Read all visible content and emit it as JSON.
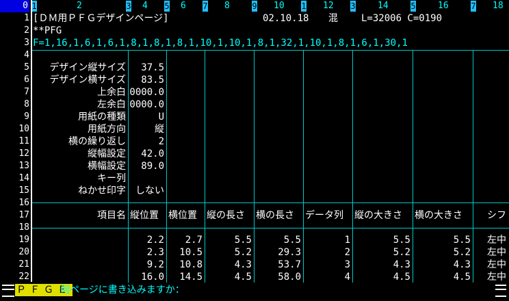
{
  "ruler": {
    "current": "0",
    "labels": [
      "1",
      "2",
      "3",
      "4",
      "5",
      "6",
      "7",
      "8",
      "9",
      "10",
      "1",
      "12",
      "3",
      "14",
      "5",
      "16",
      "7",
      "18"
    ],
    "ticks": [
      "1",
      "3",
      "5",
      "7",
      "9",
      "1",
      "3",
      "5",
      "7"
    ]
  },
  "rows": [
    "0",
    "1",
    "2",
    "3",
    "4",
    "5",
    "6",
    "7",
    "8",
    "9",
    "10",
    "11",
    "12",
    "13",
    "14",
    "15",
    "16",
    "17",
    "18",
    "19",
    "20",
    "21",
    "22"
  ],
  "header": {
    "title": "[ＤＭ用ＰＦＧデザインページ]",
    "date": "02.10.18",
    "mode": "混",
    "line_info": "L=32006 C=0190"
  },
  "line2": "**PFG",
  "line3": "F=1,16,1,6,1,6,1,8,1,8,1,8,1,10,1,10,1,8,1,32,1,10,1,8,1,6,1,30,1",
  "settings": [
    {
      "label": "デザイン縦サイズ",
      "value": "37.5"
    },
    {
      "label": "デザイン横サイズ",
      "value": "83.5"
    },
    {
      "label": "上余白",
      "value": "0000.0"
    },
    {
      "label": "左余白",
      "value": "0000.0"
    },
    {
      "label": "用紙の種類",
      "value": "U"
    },
    {
      "label": "用紙方向",
      "value": "縦"
    },
    {
      "label": "横の繰り返し",
      "value": "2"
    },
    {
      "label": "縦幅設定",
      "value": "42.0"
    },
    {
      "label": "横幅設定",
      "value": "89.0"
    },
    {
      "label": "キー列",
      "value": ""
    },
    {
      "label": "ねかせ印字",
      "value": "しない"
    }
  ],
  "table": {
    "item_header": "項目名",
    "columns": [
      "縦位置",
      "横位置",
      "縦の長さ",
      "横の長さ",
      "データ列",
      "縦の大きさ",
      "横の大きさ",
      "シフ"
    ],
    "rows": [
      [
        "2.2",
        "2.7",
        "5.5",
        "5.5",
        "1",
        "5.5",
        "5.5",
        "左中"
      ],
      [
        "2.3",
        "10.5",
        "5.2",
        "29.3",
        "2",
        "5.2",
        "5.2",
        "左中"
      ],
      [
        "9.2",
        "10.8",
        "4.3",
        "53.7",
        "3",
        "4.3",
        "4.3",
        "左中"
      ],
      [
        "16.0",
        "14.5",
        "4.5",
        "58.0",
        "4",
        "4.5",
        "4.5",
        "左中"
      ]
    ]
  },
  "status": {
    "mode_label": "ＰＦＧＥ",
    "prompt": "何ページに書き込みますか："
  }
}
